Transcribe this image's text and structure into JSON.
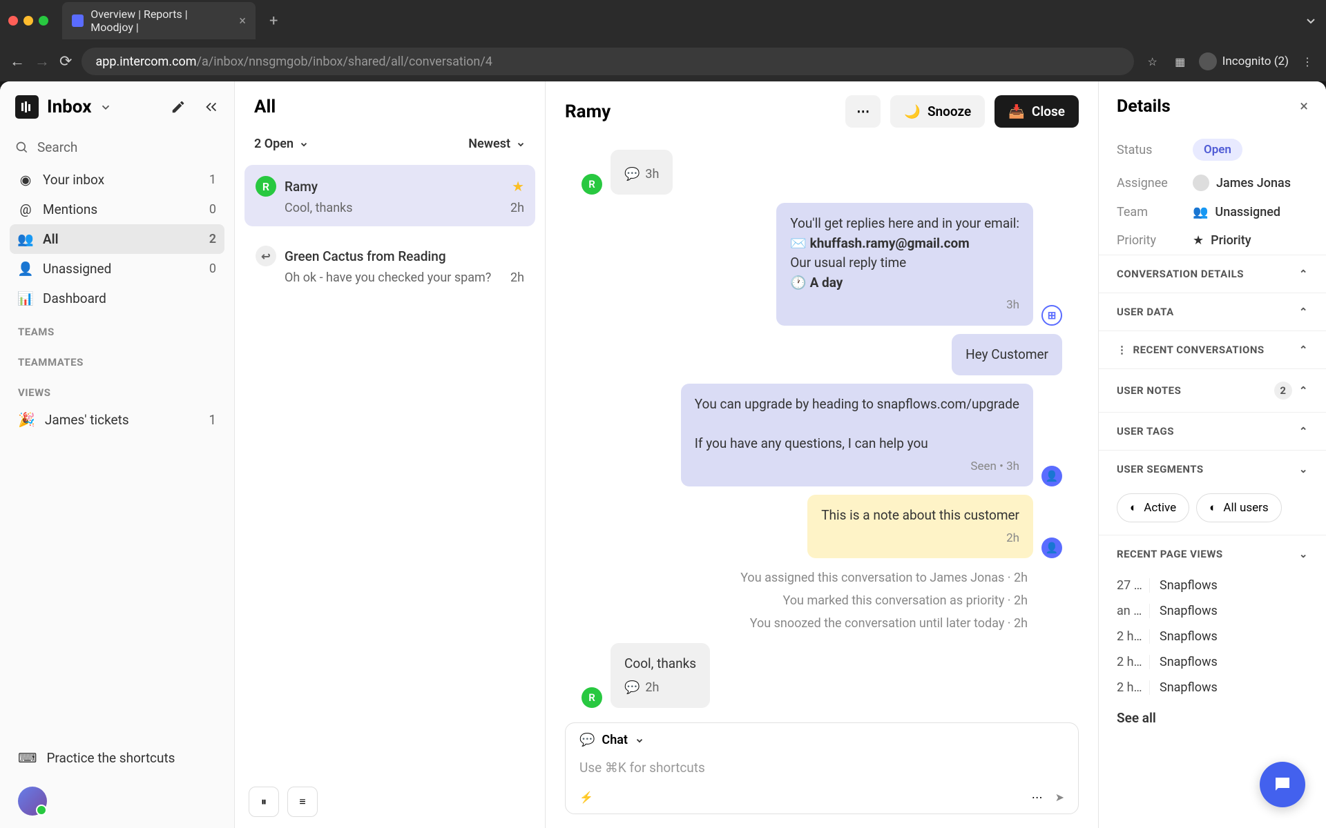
{
  "browser": {
    "tab_title": "Overview | Reports | Moodjoy |",
    "url_domain": "app.intercom.com",
    "url_path": "/a/inbox/nnsgmgob/inbox/shared/all/conversation/4",
    "incognito_label": "Incognito (2)"
  },
  "sidebar": {
    "title": "Inbox",
    "search": "Search",
    "nav": [
      {
        "label": "Your inbox",
        "count": "1",
        "icon": "inbox"
      },
      {
        "label": "Mentions",
        "count": "0",
        "icon": "at"
      },
      {
        "label": "All",
        "count": "2",
        "icon": "people",
        "active": true
      },
      {
        "label": "Unassigned",
        "count": "0",
        "icon": "unassigned"
      },
      {
        "label": "Dashboard",
        "count": "",
        "icon": "chart"
      }
    ],
    "teams_label": "TEAMS",
    "teammates_label": "TEAMMATES",
    "views_label": "VIEWS",
    "views": [
      {
        "emoji": "🎉",
        "label": "James' tickets",
        "count": "1"
      }
    ],
    "shortcuts": "Practice the shortcuts"
  },
  "conv_list": {
    "title": "All",
    "filter_open": "2 Open",
    "filter_sort": "Newest",
    "items": [
      {
        "avatar": "R",
        "avatar_color": "green",
        "name": "Ramy",
        "starred": true,
        "preview": "Cool, thanks",
        "time": "2h",
        "selected": true
      },
      {
        "avatar": "↩",
        "avatar_color": "reply",
        "name": "Green Cactus from Reading",
        "starred": false,
        "preview": "Oh ok - have you checked your spam?",
        "time": "2h",
        "selected": false
      }
    ]
  },
  "thread": {
    "title": "Ramy",
    "snooze": "Snooze",
    "close": "Close",
    "messages": {
      "m1_time": "3h",
      "auto_line1": "You'll get replies here and in your email:",
      "auto_email": "khuffash.ramy@gmail.com",
      "auto_line2": "Our usual reply time",
      "auto_line3": "🕐 A day",
      "auto_time": "3h",
      "m2": "Hey Customer",
      "m3a": "You can upgrade by heading to snapflows.com/upgrade",
      "m3b": "If you have any questions, I can help you",
      "m3_seen": "Seen • 3h",
      "note": "This is a note about this customer",
      "note_time": "2h",
      "act1": "You assigned this conversation to James Jonas · 2h",
      "act2": "You marked this conversation as priority · 2h",
      "act3": "You snoozed the conversation until later today · 2h",
      "m4": "Cool, thanks",
      "m4_time": "2h"
    },
    "composer": {
      "mode": "Chat",
      "placeholder": "Use ⌘K for shortcuts"
    }
  },
  "details": {
    "title": "Details",
    "status_label": "Status",
    "status_value": "Open",
    "assignee_label": "Assignee",
    "assignee_value": "James Jonas",
    "team_label": "Team",
    "team_value": "Unassigned",
    "priority_label": "Priority",
    "priority_value": "Priority",
    "sections": {
      "conversation_details": "CONVERSATION DETAILS",
      "user_data": "USER DATA",
      "recent_conversations": "RECENT CONVERSATIONS",
      "user_notes": "USER NOTES",
      "user_notes_count": "2",
      "user_tags": "USER TAGS",
      "user_segments": "USER SEGMENTS",
      "recent_page_views": "RECENT PAGE VIEWS"
    },
    "segments": [
      {
        "icon": "pie",
        "label": "Active"
      },
      {
        "icon": "pie",
        "label": "All users"
      }
    ],
    "pageviews": [
      {
        "time": "27 …",
        "page": "Snapflows"
      },
      {
        "time": "an …",
        "page": "Snapflows"
      },
      {
        "time": "2 h…",
        "page": "Snapflows"
      },
      {
        "time": "2 h…",
        "page": "Snapflows"
      },
      {
        "time": "2 h…",
        "page": "Snapflows"
      }
    ],
    "see_all": "See all"
  }
}
